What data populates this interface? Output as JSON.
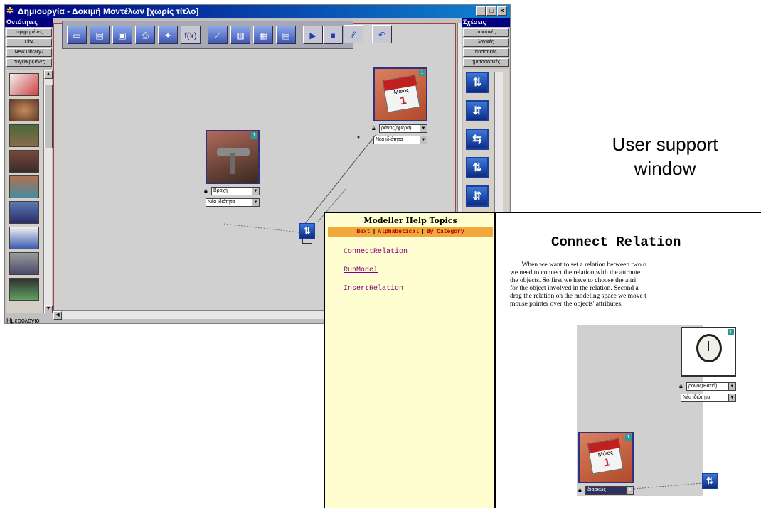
{
  "main_window": {
    "title": "Δημιουργία - Δοκιμή Μοντέλων [χωρίς τίτλο]",
    "window_buttons": [
      "_",
      "□",
      "×"
    ],
    "left_panel": {
      "header": "Οντότητες",
      "library_buttons": [
        "αφηρημένες",
        "Lib4",
        "New Library2",
        "συγκεκριμένες"
      ],
      "footer_label": "Ημερολόγιο"
    },
    "right_panel": {
      "header": "Σχέσεις",
      "category_buttons": [
        "ποιοτικές",
        "λογικές",
        "ποσοτικές",
        "ημιποσοτικές"
      ]
    },
    "toolbar": {
      "fx_label": "f(x)"
    },
    "objects": [
      {
        "name": "calendar",
        "card_title": "Μάιος",
        "card_day": "1",
        "badge": "1",
        "attr_value": "ράνος(ημέρα)",
        "prop_value": "Νέα ιδιότητα"
      },
      {
        "name": "tap",
        "badge": "1",
        "attr_value": "Βροχή",
        "prop_value": "Νέα ιδιότητα"
      }
    ]
  },
  "annotation": {
    "line1": "User support",
    "line2": "window"
  },
  "help_window": {
    "title": "Modeller Help Topics",
    "nav": [
      "Next",
      "Alphabetical",
      "By Category"
    ],
    "topics": [
      "ConnectRelation",
      "RunModel",
      "InsertRelation"
    ],
    "heading": "Connect Relation",
    "body": "       When we want to set a relation between two o\nwe need to connect the relation with the attrbute\nthe objects. So first we have to choose the attri\nfor the object involved in the relation. Second a\ndrag the relation on the modeling space we move t\nmouse pointer over the objects' attributes.",
    "image_objects": [
      {
        "name": "clock",
        "badge": "1",
        "attr_value": "ρόνος(Βατιά)",
        "prop_value": "Νέα ιδιότητα"
      },
      {
        "name": "calendar",
        "card_title": "Μάιος",
        "card_day": "1",
        "badge": "1",
        "attr_value": "διαρκώς"
      }
    ]
  },
  "colors": {
    "titlebar": "#000080",
    "help_sidebar": "#fffed0",
    "help_navbar": "#f2a93b",
    "relation_icon": "#1a5fc8"
  }
}
